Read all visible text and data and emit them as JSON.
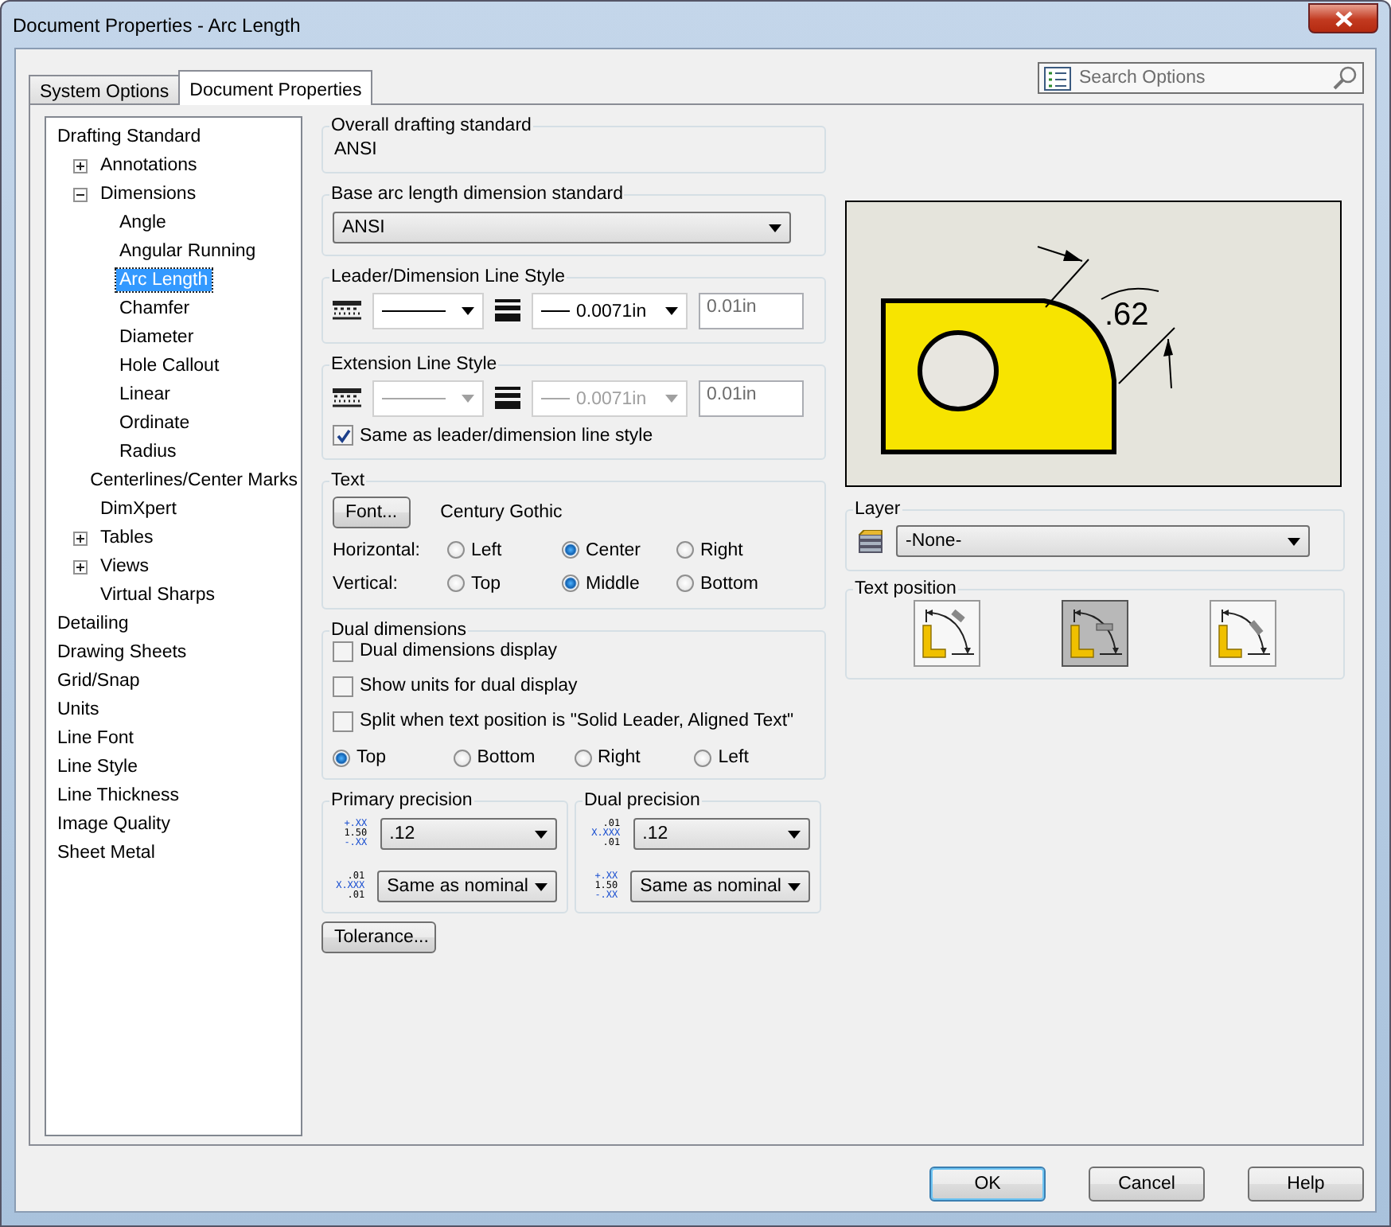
{
  "window": {
    "title": "Document Properties - Arc Length"
  },
  "tabs": [
    {
      "label": "System Options",
      "selected": false
    },
    {
      "label": "Document Properties",
      "selected": true
    }
  ],
  "search": {
    "placeholder": "Search Options"
  },
  "tree": [
    {
      "label": "Drafting Standard",
      "selected": false,
      "children": [
        {
          "label": "Annotations",
          "selected": false,
          "expanded": false
        },
        {
          "label": "Dimensions",
          "selected": false,
          "expanded": true,
          "children": [
            {
              "label": "Angle",
              "selected": false
            },
            {
              "label": "Angular Running",
              "selected": false
            },
            {
              "label": "Arc Length",
              "selected": true
            },
            {
              "label": "Chamfer",
              "selected": false
            },
            {
              "label": "Diameter",
              "selected": false
            },
            {
              "label": "Hole Callout",
              "selected": false
            },
            {
              "label": "Linear",
              "selected": false
            },
            {
              "label": "Ordinate",
              "selected": false
            },
            {
              "label": "Radius",
              "selected": false
            }
          ]
        },
        {
          "label": "Centerlines/Center Marks",
          "selected": false
        },
        {
          "label": "DimXpert",
          "selected": false
        },
        {
          "label": "Tables",
          "selected": false,
          "expanded": false
        },
        {
          "label": "Views",
          "selected": false,
          "expanded": false
        },
        {
          "label": "Virtual Sharps",
          "selected": false
        }
      ]
    },
    {
      "label": "Detailing",
      "selected": false
    },
    {
      "label": "Drawing Sheets",
      "selected": false
    },
    {
      "label": "Grid/Snap",
      "selected": false
    },
    {
      "label": "Units",
      "selected": false
    },
    {
      "label": "Line Font",
      "selected": false
    },
    {
      "label": "Line Style",
      "selected": false
    },
    {
      "label": "Line Thickness",
      "selected": false
    },
    {
      "label": "Image Quality",
      "selected": false
    },
    {
      "label": "Sheet Metal",
      "selected": false
    }
  ],
  "overall": {
    "title": "Overall drafting standard",
    "value": "ANSI"
  },
  "base_arc": {
    "title": "Base arc length dimension standard",
    "value": "ANSI"
  },
  "leader_style": {
    "title": "Leader/Dimension Line Style",
    "disabled": false,
    "thickness": "0.0071in",
    "custom": "0.01in"
  },
  "extension_style": {
    "title": "Extension Line Style",
    "disabled": true,
    "thickness": "0.0071in",
    "custom": "0.01in",
    "same_as": {
      "label": "Same as leader/dimension line style",
      "checked": true
    }
  },
  "text": {
    "title": "Text",
    "font_button": "Font...",
    "font_name": "Century Gothic",
    "rows": [
      {
        "label": "Horizontal:",
        "options": [
          {
            "label": "Left",
            "selected": false
          },
          {
            "label": "Center",
            "selected": true
          },
          {
            "label": "Right",
            "selected": false
          }
        ]
      },
      {
        "label": "Vertical:",
        "options": [
          {
            "label": "Top",
            "selected": false
          },
          {
            "label": "Middle",
            "selected": true
          },
          {
            "label": "Bottom",
            "selected": false
          }
        ]
      }
    ]
  },
  "dual": {
    "title": "Dual dimensions",
    "checks": [
      {
        "label": "Dual dimensions display",
        "checked": false
      },
      {
        "label": "Show units for dual display",
        "checked": false
      },
      {
        "label": "Split when text position is \"Solid Leader, Aligned Text\"",
        "checked": false
      }
    ],
    "options": [
      {
        "label": "Top",
        "selected": true
      },
      {
        "label": "Bottom",
        "selected": false
      },
      {
        "label": "Right",
        "selected": false
      },
      {
        "label": "Left",
        "selected": false
      }
    ]
  },
  "precision": [
    {
      "title": "Primary precision",
      "rows": [
        {
          "kind": "tolerance",
          "lines": [
            "+.XX",
            "1.50",
            "-.XX"
          ],
          "value": ".12"
        },
        {
          "kind": "fraction",
          "lines": [
            ".01",
            "X.XXX",
            ".01"
          ],
          "value": "Same as nominal"
        }
      ]
    },
    {
      "title": "Dual precision",
      "rows": [
        {
          "kind": "fraction",
          "lines": [
            ".01",
            "X.XXX",
            ".01"
          ],
          "value": ".12"
        },
        {
          "kind": "tolerance",
          "lines": [
            "+.XX",
            "1.50",
            "-.XX"
          ],
          "value": "Same as nominal"
        }
      ]
    }
  ],
  "tolerance_button": "Tolerance...",
  "preview": {
    "dimension": ".62"
  },
  "layer": {
    "title": "Layer",
    "value": "-None-"
  },
  "text_position": {
    "title": "Text position",
    "options": [
      {
        "kind": "aligned",
        "selected": false
      },
      {
        "kind": "horizontal",
        "selected": true
      },
      {
        "kind": "inline",
        "selected": false
      }
    ]
  },
  "buttons": [
    {
      "label": "OK",
      "default": true
    },
    {
      "label": "Cancel",
      "default": false
    },
    {
      "label": "Help",
      "default": false
    }
  ]
}
